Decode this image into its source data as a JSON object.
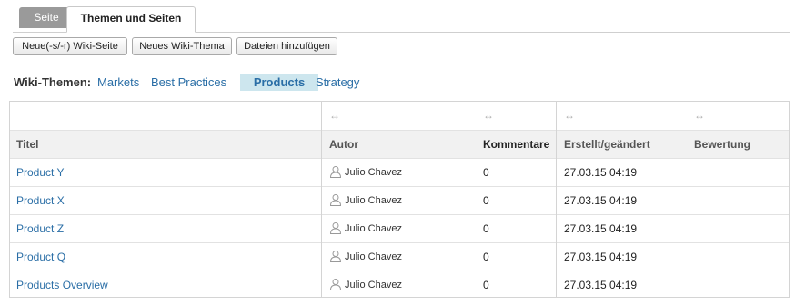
{
  "tabs": [
    {
      "label": "Seite"
    },
    {
      "label": "Themen und Seiten"
    }
  ],
  "toolbar": {
    "new_page": "Neue(-s/-r) Wiki-Seite",
    "new_topic": "Neues Wiki-Thema",
    "add_files": "Dateien hinzufügen"
  },
  "topics": {
    "label": "Wiki-Themen:",
    "items": [
      "Markets",
      "Best Practices",
      "Products",
      "Strategy"
    ],
    "active": "Products"
  },
  "table": {
    "resize_glyph": "↔",
    "columns": [
      "Titel",
      "Autor",
      "Kommentare",
      "Erstellt/geändert",
      "Bewertung"
    ],
    "rows": [
      {
        "title": "Product Y",
        "author": "Julio Chavez",
        "comments": "0",
        "date": "27.03.15 04:19",
        "rating": ""
      },
      {
        "title": "Product X",
        "author": "Julio Chavez",
        "comments": "0",
        "date": "27.03.15 04:19",
        "rating": ""
      },
      {
        "title": "Product Z",
        "author": "Julio Chavez",
        "comments": "0",
        "date": "27.03.15 04:19",
        "rating": ""
      },
      {
        "title": "Product Q",
        "author": "Julio Chavez",
        "comments": "0",
        "date": "27.03.15 04:19",
        "rating": ""
      },
      {
        "title": "Products Overview",
        "author": "Julio Chavez",
        "comments": "0",
        "date": "27.03.15 04:19",
        "rating": ""
      }
    ]
  },
  "icons": {
    "author": "user-icon",
    "resize": "resize-handle-icon"
  },
  "colors": {
    "link": "#2a6ea6",
    "active_topic_bg": "#cde6ee",
    "inactive_tab": "#9a9a9a"
  }
}
